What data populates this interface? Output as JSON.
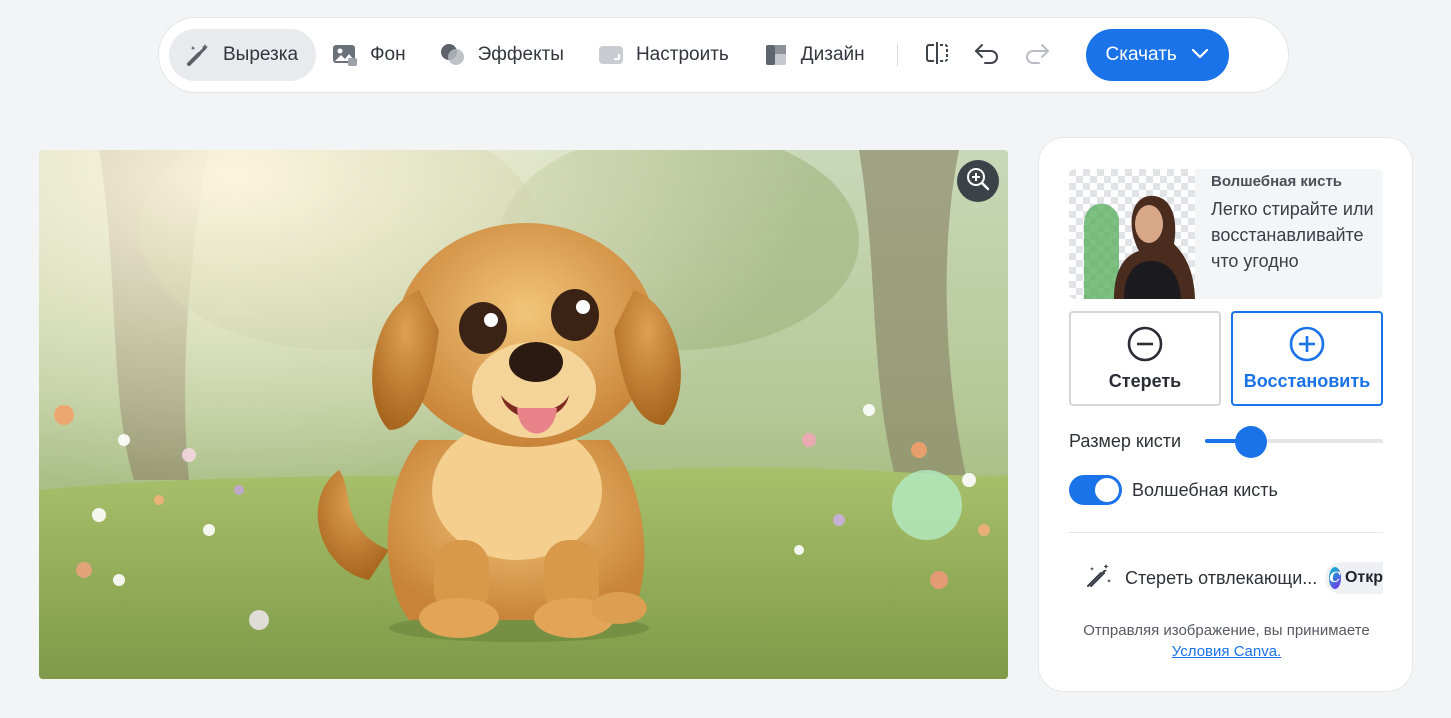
{
  "toolbar": {
    "tabs": [
      {
        "label": "Вырезка",
        "icon": "brush-sparkle-icon",
        "active": true
      },
      {
        "label": "Фон",
        "icon": "image-icon",
        "active": false
      },
      {
        "label": "Эффекты",
        "icon": "effects-icon",
        "active": false
      },
      {
        "label": "Настроить",
        "icon": "adjust-icon",
        "active": false
      },
      {
        "label": "Дизайн",
        "icon": "design-icon",
        "active": false
      }
    ],
    "compare_icon": "compare-icon",
    "undo_icon": "undo-icon",
    "redo_icon": "redo-icon",
    "download_label": "Скачать"
  },
  "canvas": {
    "zoom_icon": "zoom-in-icon"
  },
  "panel": {
    "promo": {
      "title": "Волшебная кисть",
      "description": "Легко стирайте или восстанавливайте что угодно"
    },
    "erase_label": "Стереть",
    "restore_label": "Восстановить",
    "brush_size_label": "Размер кисти",
    "brush_size_value": 0.26,
    "magic_brush_label": "Волшебная кисть",
    "magic_brush_on": true,
    "distractions_label": "Стереть отвлекающи...",
    "pro_label": "Откр",
    "terms_text": "Отправляя изображение, вы принимаете",
    "terms_link": "Условия Canva."
  },
  "colors": {
    "accent": "#1a73e8",
    "brush_preview": "#b2e8be"
  }
}
